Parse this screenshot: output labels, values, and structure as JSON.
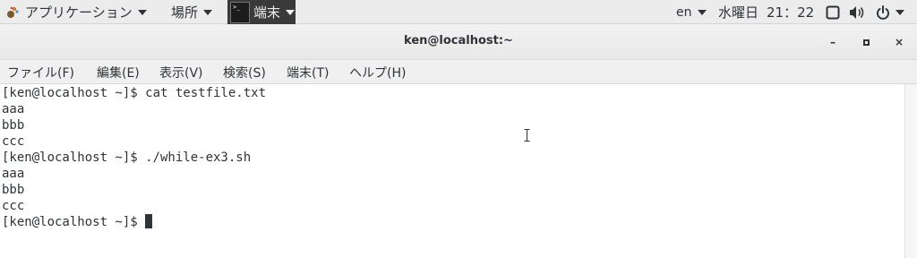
{
  "topbar": {
    "apps_label": "アプリケーション",
    "places_label": "場所",
    "terminal_label": "端末",
    "lang": "en",
    "day": "水曜日",
    "time": "21：22"
  },
  "window": {
    "title": "ken@localhost:~",
    "minimize": "–",
    "maximize": "□",
    "close": "×"
  },
  "menu": {
    "items": [
      "ファイル(F)",
      "編集(E)",
      "表示(V)",
      "検索(S)",
      "端末(T)",
      "ヘルプ(H)"
    ]
  },
  "terminal": {
    "lines": [
      "[ken@localhost ~]$ cat testfile.txt",
      "aaa",
      "bbb",
      "ccc",
      "[ken@localhost ~]$ ./while-ex3.sh",
      "aaa",
      "bbb",
      "ccc",
      "[ken@localhost ~]$ "
    ]
  },
  "colors": {
    "text": "#2e3436",
    "terminal_bg": "#ffffff",
    "topbar_bg": "#ececec"
  }
}
